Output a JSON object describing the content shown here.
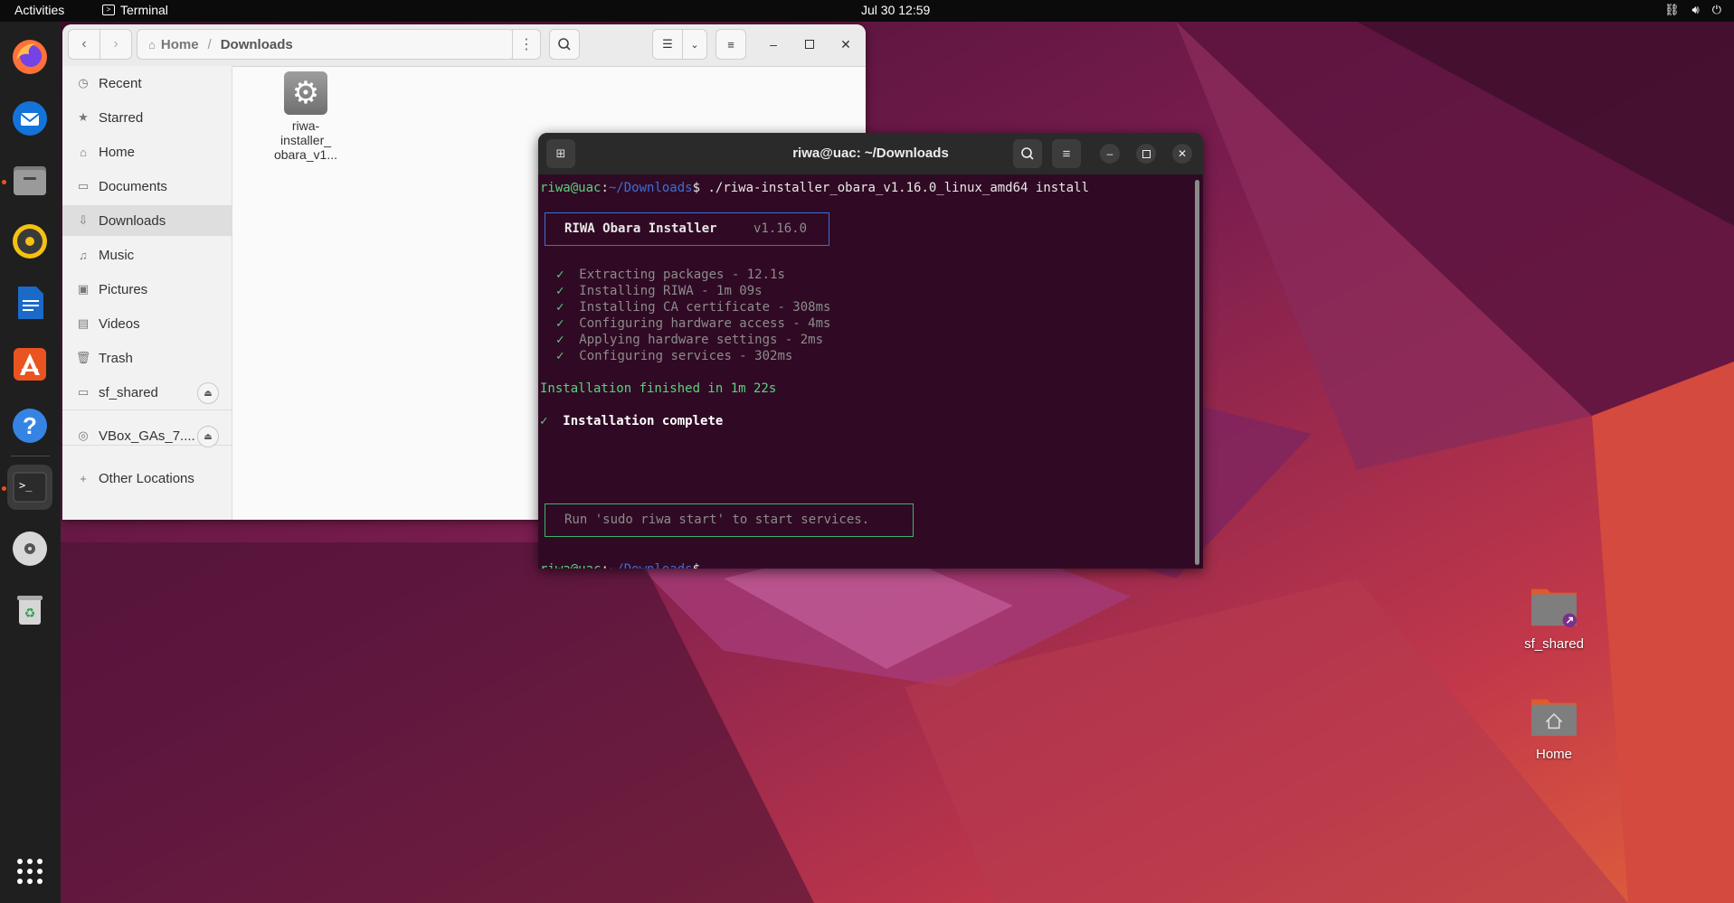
{
  "topbar": {
    "activities": "Activities",
    "app_name": "Terminal",
    "clock": "Jul 30  12:59"
  },
  "dock": {
    "items": [
      "firefox-icon",
      "thunderbird-icon",
      "files-icon",
      "rhythmbox-icon",
      "writer-icon",
      "app-center-icon",
      "help-icon",
      "terminal-icon",
      "dvd-icon",
      "trash-icon",
      "app-grid-icon"
    ]
  },
  "files": {
    "breadcrumb": {
      "home": "Home",
      "sep": "/",
      "current": "Downloads"
    },
    "sidebar": {
      "items": [
        {
          "label": "Recent",
          "icon": "clock-icon"
        },
        {
          "label": "Starred",
          "icon": "star-icon"
        },
        {
          "label": "Home",
          "icon": "home-icon"
        },
        {
          "label": "Documents",
          "icon": "document-icon"
        },
        {
          "label": "Downloads",
          "icon": "download-icon"
        },
        {
          "label": "Music",
          "icon": "music-icon"
        },
        {
          "label": "Pictures",
          "icon": "picture-icon"
        },
        {
          "label": "Videos",
          "icon": "video-icon"
        },
        {
          "label": "Trash",
          "icon": "trash-icon"
        },
        {
          "label": "sf_shared",
          "icon": "drive-icon"
        },
        {
          "label": "VBox_GAs_7....",
          "icon": "disc-icon"
        },
        {
          "label": "Other Locations",
          "icon": "plus-icon"
        }
      ]
    },
    "file": {
      "name_line1": "riwa-",
      "name_line2": "installer_",
      "name_line3": "obara_v1..."
    }
  },
  "terminal": {
    "title": "riwa@uac: ~/Downloads",
    "prompt_user": "riwa@uac",
    "prompt_colon": ":",
    "prompt_path": "~/Downloads",
    "prompt_dollar": "$",
    "command": " ./riwa-installer_obara_v1.16.0_linux_amd64 install",
    "installer_title": "RIWA Obara Installer",
    "installer_version": "v1.16.0",
    "check": "✓",
    "steps": [
      "Extracting packages - 12.1s",
      "Installing RIWA - 1m 09s",
      "Installing CA certificate - 308ms",
      "Configuring hardware access - 4ms",
      "Applying hardware settings - 2ms",
      "Configuring services - 302ms"
    ],
    "finished": "Installation finished in 1m 22s",
    "complete": "Installation complete",
    "hint": "Run 'sudo riwa start' to start services."
  },
  "desktop": {
    "icons": [
      {
        "label": "sf_shared"
      },
      {
        "label": "Home"
      }
    ]
  }
}
